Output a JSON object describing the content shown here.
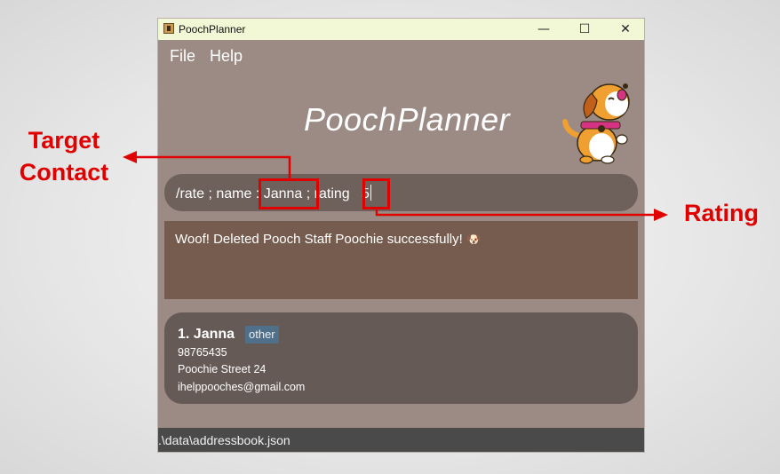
{
  "window": {
    "title": "PoochPlanner",
    "controls": {
      "minimize": "—",
      "maximize": "☐",
      "close": "✕"
    }
  },
  "menu": {
    "file": "File",
    "help": "Help"
  },
  "header": {
    "app_title": "PoochPlanner"
  },
  "command": {
    "text": "/rate ; name : Janna ; rating   5"
  },
  "result": {
    "message": "Woof! Deleted Pooch Staff Poochie successfully!",
    "emoji": "🐶"
  },
  "contacts": [
    {
      "index_name": "1.  Janna",
      "tag": "other",
      "phone": "98765435",
      "address": "Poochie Street 24",
      "email": "ihelppooches@gmail.com"
    }
  ],
  "status": {
    "file_path": ".\\data\\addressbook.json"
  },
  "annotations": {
    "target_contact": "Target\nContact",
    "rating": "Rating",
    "color": "#e00000"
  }
}
